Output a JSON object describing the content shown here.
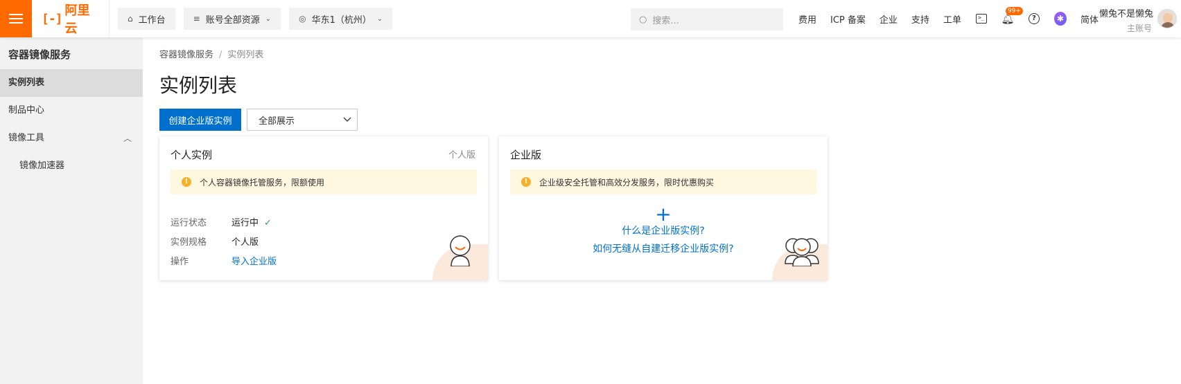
{
  "brand": {
    "mark": "[-]",
    "name": "阿里云",
    "accent": "#ff6a00",
    "primary": "#0070cc"
  },
  "topbar": {
    "workbench": "工作台",
    "resource_scope": "账号全部资源",
    "region": "华东1（杭州）",
    "search_placeholder": "搜索...",
    "links": [
      "费用",
      "ICP 备案",
      "企业",
      "支持",
      "工单"
    ],
    "notification_count": "99+",
    "language": "简体",
    "user_name": "懒兔不是懒兔",
    "user_role": "主账号"
  },
  "sidebar": {
    "title": "容器镜像服务",
    "items": [
      {
        "label": "实例列表",
        "active": true
      },
      {
        "label": "制品中心"
      },
      {
        "label": "镜像工具",
        "expanded": true
      },
      {
        "label": "镜像加速器",
        "sub": true
      }
    ]
  },
  "main": {
    "breadcrumb": [
      "容器镜像服务",
      "实例列表"
    ],
    "title": "实例列表",
    "create_button": "创建企业版实例",
    "filter_select": "全部展示",
    "personal_card": {
      "title": "个人实例",
      "tag": "个人版",
      "notice": "个人容器镜像托管服务，限额使用",
      "rows": [
        {
          "key": "运行状态",
          "value": "运行中"
        },
        {
          "key": "实例规格",
          "value": "个人版"
        },
        {
          "key": "操作",
          "value": "导入企业版"
        }
      ]
    },
    "enterprise_card": {
      "title": "企业版",
      "notice": "企业级安全托管和高效分发服务，限时优惠购买",
      "plus": "+",
      "link1": "什么是企业版实例?",
      "link2": "如何无缝从自建迁移企业版实例?"
    }
  }
}
